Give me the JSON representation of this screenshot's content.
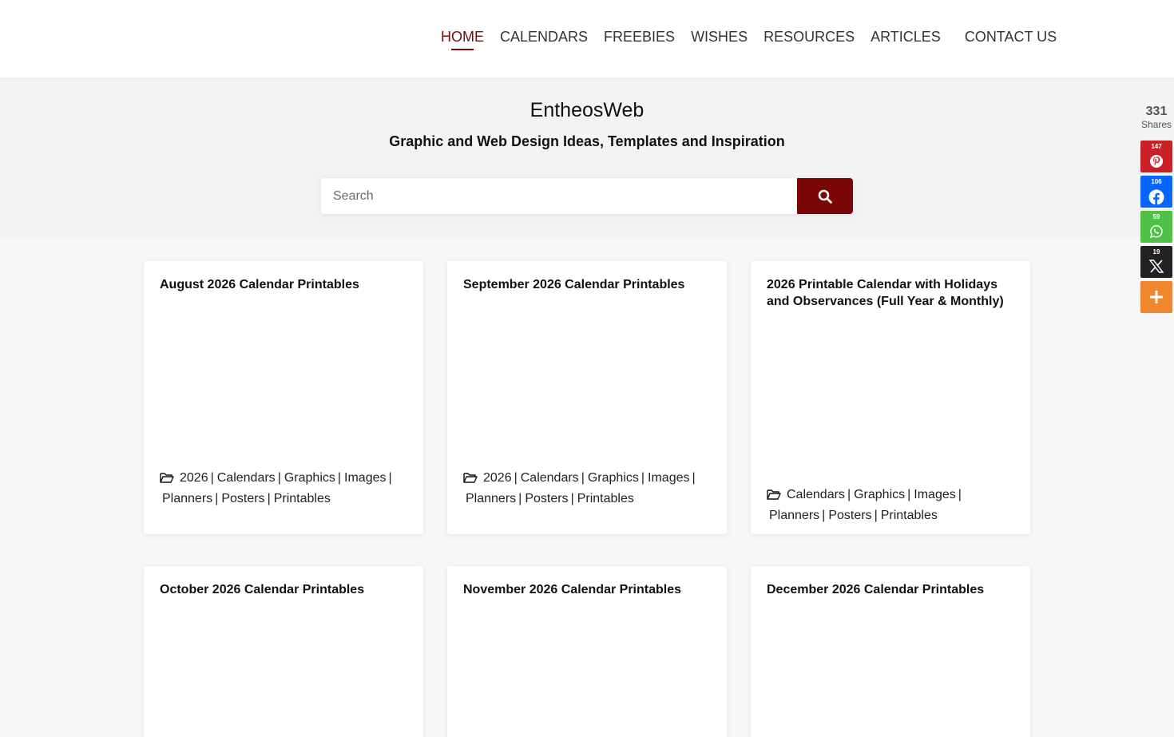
{
  "nav": {
    "items": [
      {
        "label": "HOME",
        "active": true
      },
      {
        "label": "CALENDARS"
      },
      {
        "label": "FREEBIES"
      },
      {
        "label": "WISHES"
      },
      {
        "label": "RESOURCES"
      },
      {
        "label": "ARTICLES"
      },
      {
        "label": "CONTACT US"
      }
    ]
  },
  "hero": {
    "site_title": "EntheosWeb",
    "tagline": "Graphic and Web Design Ideas, Templates and Inspiration"
  },
  "search": {
    "placeholder": "Search"
  },
  "posts": [
    {
      "title": "August 2026 Calendar Printables",
      "categories": [
        "2026",
        "Calendars",
        "Graphics",
        "Images",
        "Planners",
        "Posters",
        "Printables"
      ]
    },
    {
      "title": "September 2026 Calendar Printables",
      "categories": [
        "2026",
        "Calendars",
        "Graphics",
        "Images",
        "Planners",
        "Posters",
        "Printables"
      ]
    },
    {
      "title": "2026 Printable Calendar with Holidays and Observances (Full Year & Monthly)",
      "categories": [
        "Calendars",
        "Graphics",
        "Images",
        "Planners",
        "Posters",
        "Printables"
      ]
    },
    {
      "title": "October 2026 Calendar Printables",
      "categories": []
    },
    {
      "title": "November 2026 Calendar Printables",
      "categories": []
    },
    {
      "title": "December 2026 Calendar Printables",
      "categories": []
    }
  ],
  "share": {
    "total": "331",
    "label": "Shares",
    "buttons": [
      {
        "network": "pinterest",
        "count": "147",
        "color": "#cb2027",
        "icon": "pinterest-icon"
      },
      {
        "network": "facebook",
        "count": "106",
        "color": "#0866ff",
        "icon": "facebook-icon"
      },
      {
        "network": "whatsapp",
        "count": "59",
        "color": "#4dc247",
        "icon": "whatsapp-icon"
      },
      {
        "network": "x",
        "count": "19",
        "color": "#222222",
        "icon": "x-icon"
      },
      {
        "network": "more",
        "count": "",
        "color": "#f0872f",
        "icon": "plus-icon"
      }
    ]
  },
  "colors": {
    "accent": "#7a0606",
    "hero_bg": "#f3f3f3",
    "page_bg": "#f7f7f7"
  }
}
